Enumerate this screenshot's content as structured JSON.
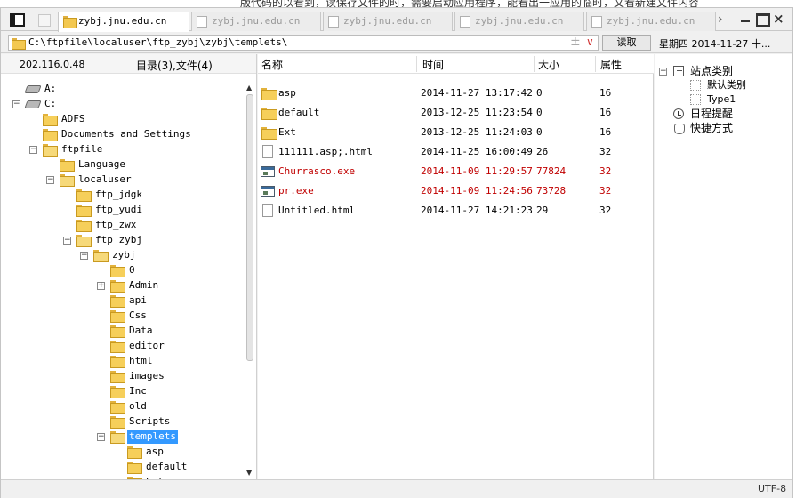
{
  "background_text": "版代码的以看到，读保存文件的时，需要启动应用程序，能看出一应用的临时，文看新建文件内容",
  "tabs": [
    {
      "label": "zybj.jnu.edu.cn",
      "active": true
    },
    {
      "label": "zybj.jnu.edu.cn",
      "active": false
    },
    {
      "label": "zybj.jnu.edu.cn",
      "active": false
    },
    {
      "label": "zybj.jnu.edu.cn",
      "active": false
    },
    {
      "label": "zybj.jnu.edu.cn",
      "active": false
    }
  ],
  "address": {
    "path": "C:\\ftpfile\\localuser\\ftp_zybj\\zybj\\templets\\",
    "plus": "±",
    "dropdown": "∨",
    "read_label": "读取"
  },
  "datetime": "星期四 2014-11-27 十...",
  "left": {
    "ip": "202.116.0.48",
    "dir_count": "目录(3),文件(4)",
    "tree": [
      {
        "label": "A:",
        "type": "drive",
        "depth": 0
      },
      {
        "label": "C:",
        "type": "drive",
        "depth": 0,
        "expander": "−"
      },
      {
        "label": "ADFS",
        "type": "folder",
        "depth": 1
      },
      {
        "label": "Documents and Settings",
        "type": "folder",
        "depth": 1
      },
      {
        "label": "ftpfile",
        "type": "folder",
        "depth": 1,
        "expander": "−"
      },
      {
        "label": "Language",
        "type": "folder",
        "depth": 2
      },
      {
        "label": "localuser",
        "type": "folder",
        "depth": 2,
        "expander": "−"
      },
      {
        "label": "ftp_jdgk",
        "type": "folder",
        "depth": 3
      },
      {
        "label": "ftp_yudi",
        "type": "folder",
        "depth": 3
      },
      {
        "label": "ftp_zwx",
        "type": "folder",
        "depth": 3
      },
      {
        "label": "ftp_zybj",
        "type": "folder",
        "depth": 3,
        "expander": "−"
      },
      {
        "label": "zybj",
        "type": "folder",
        "depth": 4,
        "expander": "−"
      },
      {
        "label": "0",
        "type": "folder",
        "depth": 5
      },
      {
        "label": "Admin",
        "type": "folder",
        "depth": 5,
        "expander": "+"
      },
      {
        "label": "api",
        "type": "folder",
        "depth": 5
      },
      {
        "label": "Css",
        "type": "folder",
        "depth": 5
      },
      {
        "label": "Data",
        "type": "folder",
        "depth": 5
      },
      {
        "label": "editor",
        "type": "folder",
        "depth": 5
      },
      {
        "label": "html",
        "type": "folder",
        "depth": 5
      },
      {
        "label": "images",
        "type": "folder",
        "depth": 5
      },
      {
        "label": "Inc",
        "type": "folder",
        "depth": 5
      },
      {
        "label": "old",
        "type": "folder",
        "depth": 5
      },
      {
        "label": "Scripts",
        "type": "folder",
        "depth": 5
      },
      {
        "label": "templets",
        "type": "folder",
        "depth": 5,
        "expander": "−",
        "selected": true
      },
      {
        "label": "asp",
        "type": "folder",
        "depth": 6
      },
      {
        "label": "default",
        "type": "folder",
        "depth": 6
      },
      {
        "label": "Ext",
        "type": "folder",
        "depth": 6
      }
    ]
  },
  "files": {
    "headers": {
      "name": "名称",
      "time": "时间",
      "size": "大小",
      "attr": "属性"
    },
    "rows": [
      {
        "name": "asp",
        "time": "2014-11-27 13:17:42",
        "size": "0",
        "attr": "16",
        "kind": "folder"
      },
      {
        "name": "default",
        "time": "2013-12-25 11:23:54",
        "size": "0",
        "attr": "16",
        "kind": "folder"
      },
      {
        "name": "Ext",
        "time": "2013-12-25 11:24:03",
        "size": "0",
        "attr": "16",
        "kind": "folder"
      },
      {
        "name": "111111.asp;.html",
        "time": "2014-11-25 16:00:49",
        "size": "26",
        "attr": "32",
        "kind": "file"
      },
      {
        "name": "Churrasco.exe",
        "time": "2014-11-09 11:29:57",
        "size": "77824",
        "attr": "32",
        "kind": "exe"
      },
      {
        "name": "pr.exe",
        "time": "2014-11-09 11:24:56",
        "size": "73728",
        "attr": "32",
        "kind": "exe"
      },
      {
        "name": "Untitled.html",
        "time": "2014-11-27 14:21:23",
        "size": "29",
        "attr": "32",
        "kind": "file"
      }
    ]
  },
  "right": {
    "items": [
      {
        "label": "站点类别",
        "icon": "site",
        "depth": 0,
        "expander": "−"
      },
      {
        "label": "默认类别",
        "icon": "dotted",
        "depth": 1
      },
      {
        "label": "Type1",
        "icon": "dotted",
        "depth": 1
      },
      {
        "label": "日程提醒",
        "icon": "clock",
        "depth": 0
      },
      {
        "label": "快捷方式",
        "icon": "hand",
        "depth": 0
      }
    ]
  },
  "status": {
    "encoding": "UTF-8"
  },
  "colors": {
    "selection": "#3399ff",
    "exe_text": "#c00000",
    "folder": "#f6cf5a"
  }
}
